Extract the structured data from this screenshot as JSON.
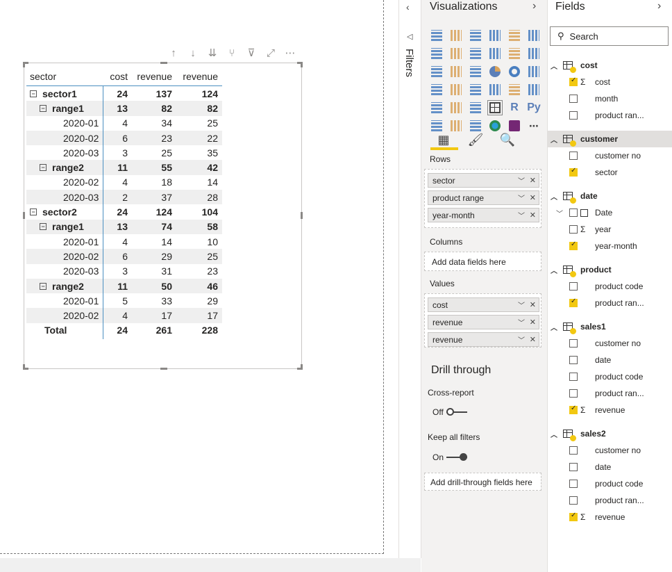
{
  "matrix": {
    "headers": [
      "sector",
      "cost",
      "revenue",
      "revenue"
    ],
    "rows": [
      {
        "label": "sector1",
        "level": 0,
        "toggle": "⊟",
        "v": [
          "24",
          "137",
          "124"
        ],
        "bold": true,
        "alt": false
      },
      {
        "label": "range1",
        "level": 1,
        "toggle": "⊟",
        "v": [
          "13",
          "82",
          "82"
        ],
        "bold": true,
        "alt": true
      },
      {
        "label": "2020-01",
        "level": 2,
        "toggle": "",
        "v": [
          "4",
          "34",
          "25"
        ],
        "bold": false,
        "alt": false
      },
      {
        "label": "2020-02",
        "level": 2,
        "toggle": "",
        "v": [
          "6",
          "23",
          "22"
        ],
        "bold": false,
        "alt": true
      },
      {
        "label": "2020-03",
        "level": 2,
        "toggle": "",
        "v": [
          "3",
          "25",
          "35"
        ],
        "bold": false,
        "alt": false
      },
      {
        "label": "range2",
        "level": 1,
        "toggle": "⊟",
        "v": [
          "11",
          "55",
          "42"
        ],
        "bold": true,
        "alt": true
      },
      {
        "label": "2020-02",
        "level": 2,
        "toggle": "",
        "v": [
          "4",
          "18",
          "14"
        ],
        "bold": false,
        "alt": false
      },
      {
        "label": "2020-03",
        "level": 2,
        "toggle": "",
        "v": [
          "2",
          "37",
          "28"
        ],
        "bold": false,
        "alt": true
      },
      {
        "label": "sector2",
        "level": 0,
        "toggle": "⊟",
        "v": [
          "24",
          "124",
          "104"
        ],
        "bold": true,
        "alt": false
      },
      {
        "label": "range1",
        "level": 1,
        "toggle": "⊟",
        "v": [
          "13",
          "74",
          "58"
        ],
        "bold": true,
        "alt": true
      },
      {
        "label": "2020-01",
        "level": 2,
        "toggle": "",
        "v": [
          "4",
          "14",
          "10"
        ],
        "bold": false,
        "alt": false
      },
      {
        "label": "2020-02",
        "level": 2,
        "toggle": "",
        "v": [
          "6",
          "29",
          "25"
        ],
        "bold": false,
        "alt": true
      },
      {
        "label": "2020-03",
        "level": 2,
        "toggle": "",
        "v": [
          "3",
          "31",
          "23"
        ],
        "bold": false,
        "alt": false
      },
      {
        "label": "range2",
        "level": 1,
        "toggle": "⊟",
        "v": [
          "11",
          "50",
          "46"
        ],
        "bold": true,
        "alt": true
      },
      {
        "label": "2020-01",
        "level": 2,
        "toggle": "",
        "v": [
          "5",
          "33",
          "29"
        ],
        "bold": false,
        "alt": false
      },
      {
        "label": "2020-02",
        "level": 2,
        "toggle": "",
        "v": [
          "4",
          "17",
          "17"
        ],
        "bold": false,
        "alt": true
      },
      {
        "label": "Total",
        "level": 1,
        "toggle": "",
        "v": [
          "24",
          "261",
          "228"
        ],
        "bold": true,
        "alt": false
      }
    ]
  },
  "visual_header_icons": [
    "drill-up-icon",
    "drill-down-icon",
    "expand-all-icon",
    "expand-hierarchy-icon",
    "filter-icon",
    "focus-mode-icon",
    "more-options-icon"
  ],
  "filters": {
    "label": "Filters"
  },
  "visualizations": {
    "title": "Visualizations",
    "tabs": [
      "fields-tab-icon",
      "format-tab-icon",
      "analytics-tab-icon"
    ],
    "rows_label": "Rows",
    "rows": [
      "sector",
      "product range",
      "year-month"
    ],
    "columns_label": "Columns",
    "columns_hint": "Add data fields here",
    "values_label": "Values",
    "values": [
      "cost",
      "revenue",
      "revenue"
    ],
    "drill_title": "Drill through",
    "cross_report_label": "Cross-report",
    "cross_report_state": "Off",
    "keep_filters_label": "Keep all filters",
    "keep_filters_state": "On",
    "drill_hint": "Add drill-through fields here",
    "colors": {
      "accent": "#f2c811",
      "report_icon": "#742774"
    }
  },
  "fields": {
    "title": "Fields",
    "search_placeholder": "Search",
    "tables": [
      {
        "name": "cost",
        "fields": [
          {
            "name": "cost",
            "checked": true,
            "sigma": true
          },
          {
            "name": "month",
            "checked": false,
            "sigma": false
          },
          {
            "name": "product ran...",
            "checked": false,
            "sigma": false
          }
        ]
      },
      {
        "name": "customer",
        "selected": true,
        "fields": [
          {
            "name": "customer no",
            "checked": false,
            "sigma": false
          },
          {
            "name": "sector",
            "checked": true,
            "sigma": false
          }
        ]
      },
      {
        "name": "date",
        "fields": [
          {
            "name": "Date",
            "checked": false,
            "sigma": false,
            "hierarchy": true
          },
          {
            "name": "year",
            "checked": false,
            "sigma": true
          },
          {
            "name": "year-month",
            "checked": true,
            "sigma": false
          }
        ]
      },
      {
        "name": "product",
        "fields": [
          {
            "name": "product code",
            "checked": false,
            "sigma": false
          },
          {
            "name": "product ran...",
            "checked": true,
            "sigma": false
          }
        ]
      },
      {
        "name": "sales1",
        "fields": [
          {
            "name": "customer no",
            "checked": false,
            "sigma": false
          },
          {
            "name": "date",
            "checked": false,
            "sigma": false
          },
          {
            "name": "product code",
            "checked": false,
            "sigma": false
          },
          {
            "name": "product ran...",
            "checked": false,
            "sigma": false
          },
          {
            "name": "revenue",
            "checked": true,
            "sigma": true
          }
        ]
      },
      {
        "name": "sales2",
        "fields": [
          {
            "name": "customer no",
            "checked": false,
            "sigma": false
          },
          {
            "name": "date",
            "checked": false,
            "sigma": false
          },
          {
            "name": "product code",
            "checked": false,
            "sigma": false
          },
          {
            "name": "product ran...",
            "checked": false,
            "sigma": false
          },
          {
            "name": "revenue",
            "checked": true,
            "sigma": true
          }
        ]
      }
    ]
  }
}
